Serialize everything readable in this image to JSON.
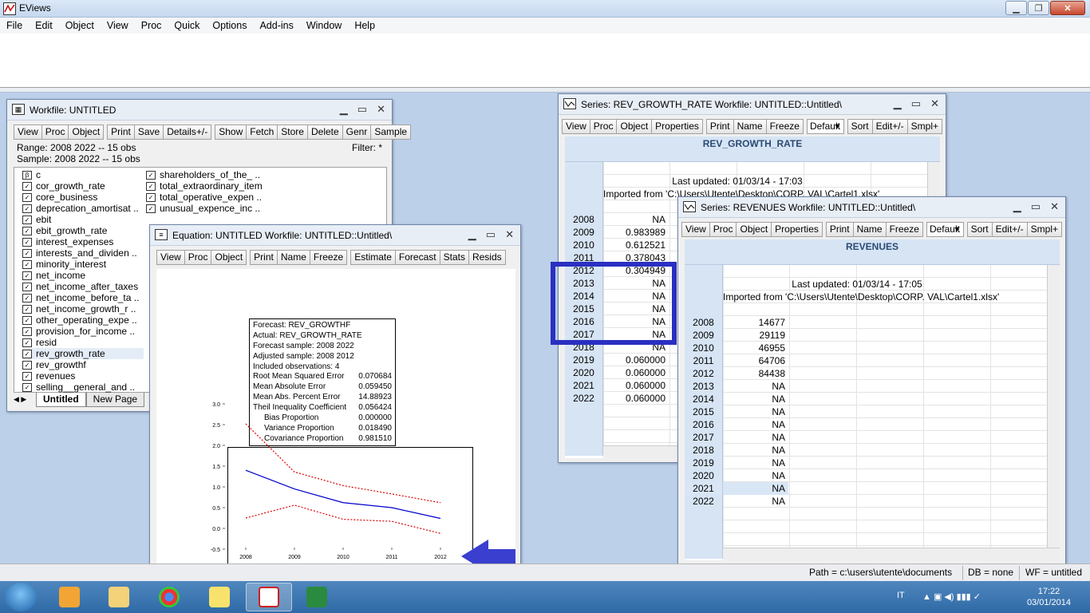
{
  "app": {
    "title": "EViews",
    "menu": [
      "File",
      "Edit",
      "Object",
      "View",
      "Proc",
      "Quick",
      "Options",
      "Add-ins",
      "Window",
      "Help"
    ]
  },
  "workfile": {
    "title": "Workfile: UNTITLED",
    "toolbar": [
      "View",
      "Proc",
      "Object",
      "Print",
      "Save",
      "Details+/-",
      "Show",
      "Fetch",
      "Store",
      "Delete",
      "Genr",
      "Sample"
    ],
    "range": "Range:   2008 2022   --   15 obs",
    "sample": "Sample: 2008 2022   --   15 obs",
    "filter": "Filter: *",
    "col1": [
      "c",
      "cor_growth_rate",
      "core_business",
      "deprecation_amortisat ..",
      "ebit",
      "ebit_growth_rate",
      "interest_expenses",
      "interests_and_dividen ..",
      "minority_interest",
      "net_income",
      "net_income_after_taxes",
      "net_income_before_ta ..",
      "net_income_growth_r ..",
      "other_operating_expe ..",
      "provision_for_income ..",
      "resid",
      "rev_growth_rate",
      "rev_growthf",
      "revenues",
      "selling__general_and .."
    ],
    "col2": [
      "shareholders_of_the_ ..",
      "total_extraordinary_item",
      "total_operative_expen ..",
      "unusual_expence_inc .."
    ],
    "tabs": [
      "Untitled",
      "New Page"
    ]
  },
  "equation": {
    "title": "Equation: UNTITLED   Workfile: UNTITLED::Untitled\\",
    "toolbar": [
      "View",
      "Proc",
      "Object",
      "Print",
      "Name",
      "Freeze",
      "Estimate",
      "Forecast",
      "Stats",
      "Resids"
    ],
    "stats": [
      {
        "k": "Forecast: REV_GROWTHF",
        "v": ""
      },
      {
        "k": "Actual: REV_GROWTH_RATE",
        "v": ""
      },
      {
        "k": "Forecast sample: 2008 2022",
        "v": ""
      },
      {
        "k": "Adjusted sample: 2008 2012",
        "v": ""
      },
      {
        "k": "Included observations: 4",
        "v": ""
      },
      {
        "k": "Root Mean Squared Error",
        "v": "0.070684"
      },
      {
        "k": "Mean Absolute Error",
        "v": "0.059450"
      },
      {
        "k": "Mean Abs. Percent Error",
        "v": "14.88923"
      },
      {
        "k": "Theil Inequality Coefficient",
        "v": "0.056424"
      },
      {
        "k": "Bias Proportion",
        "v": "0.000000"
      },
      {
        "k": "Variance Proportion",
        "v": "0.018490"
      },
      {
        "k": "Covariance Proportion",
        "v": "0.981510"
      }
    ]
  },
  "chart_data": {
    "type": "line",
    "x": [
      "2008",
      "2009",
      "2010",
      "2011",
      "2012"
    ],
    "ylim": [
      -0.5,
      3.0
    ],
    "yticks": [
      "3.0",
      "2.5",
      "2.0",
      "1.5",
      "1.0",
      "0.5",
      "0.0",
      "-0.5"
    ],
    "series": [
      {
        "name": "",
        "color": "#0000cc",
        "values": [
          1.4,
          0.95,
          0.62,
          0.5,
          0.24
        ]
      },
      {
        "name": "",
        "color": "#dd0000",
        "values": [
          2.52,
          1.36,
          1.03,
          0.83,
          0.62
        ]
      },
      {
        "name": "",
        "color": "#dd0000",
        "values": [
          0.25,
          0.56,
          0.22,
          0.17,
          -0.12
        ]
      }
    ]
  },
  "series1": {
    "title": "Series: REV_GROWTH_RATE   Workfile: UNTITLED::Untitled\\",
    "toolbar1": [
      "View",
      "Proc",
      "Object",
      "Properties"
    ],
    "toolbar2": [
      "Print",
      "Name",
      "Freeze"
    ],
    "combo": "Default",
    "toolbar3": [
      "Sort",
      "Edit+/-",
      "Smpl+"
    ],
    "header": "REV_GROWTH_RATE",
    "updated": "Last updated: 01/03/14 - 17:03",
    "imported": "Imported from 'C:\\Users\\Utente\\Desktop\\CORP. VAL\\Cartel1.xlsx'",
    "rows": [
      {
        "y": "2008",
        "v": "NA"
      },
      {
        "y": "2009",
        "v": "0.983989"
      },
      {
        "y": "2010",
        "v": "0.612521"
      },
      {
        "y": "2011",
        "v": "0.378043"
      },
      {
        "y": "2012",
        "v": "0.304949"
      },
      {
        "y": "2013",
        "v": "NA"
      },
      {
        "y": "2014",
        "v": "NA"
      },
      {
        "y": "2015",
        "v": "NA"
      },
      {
        "y": "2016",
        "v": "NA"
      },
      {
        "y": "2017",
        "v": "NA"
      },
      {
        "y": "2018",
        "v": "NA"
      },
      {
        "y": "2019",
        "v": "0.060000"
      },
      {
        "y": "2020",
        "v": "0.060000"
      },
      {
        "y": "2021",
        "v": "0.060000"
      },
      {
        "y": "2022",
        "v": "0.060000"
      }
    ]
  },
  "series2": {
    "title": "Series: REVENUES   Workfile: UNTITLED::Untitled\\",
    "toolbar1": [
      "View",
      "Proc",
      "Object",
      "Properties"
    ],
    "toolbar2": [
      "Print",
      "Name",
      "Freeze"
    ],
    "combo": "Default",
    "toolbar3": [
      "Sort",
      "Edit+/-",
      "Smpl+"
    ],
    "header": "REVENUES",
    "updated": "Last updated: 01/03/14 - 17:05",
    "imported": "Imported from 'C:\\Users\\Utente\\Desktop\\CORP. VAL\\Cartel1.xlsx'",
    "rows": [
      {
        "y": "2008",
        "v": "14677"
      },
      {
        "y": "2009",
        "v": "29119"
      },
      {
        "y": "2010",
        "v": "46955"
      },
      {
        "y": "2011",
        "v": "64706"
      },
      {
        "y": "2012",
        "v": "84438"
      },
      {
        "y": "2013",
        "v": "NA"
      },
      {
        "y": "2014",
        "v": "NA"
      },
      {
        "y": "2015",
        "v": "NA"
      },
      {
        "y": "2016",
        "v": "NA"
      },
      {
        "y": "2017",
        "v": "NA"
      },
      {
        "y": "2018",
        "v": "NA"
      },
      {
        "y": "2019",
        "v": "NA"
      },
      {
        "y": "2020",
        "v": "NA"
      },
      {
        "y": "2021",
        "v": "NA"
      },
      {
        "y": "2022",
        "v": "NA"
      }
    ]
  },
  "status": {
    "path": "Path = c:\\users\\utente\\documents",
    "db": "DB = none",
    "wf": "WF = untitled"
  },
  "tray": {
    "lang": "IT",
    "time": "17:22",
    "date": "03/01/2014"
  }
}
